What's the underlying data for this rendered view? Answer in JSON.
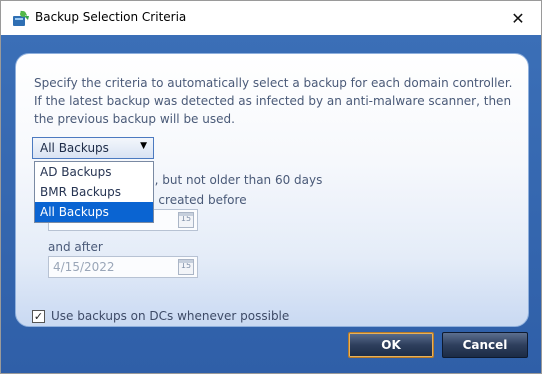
{
  "window": {
    "title": "Backup Selection Criteria"
  },
  "description": "Specify the criteria to automatically select a backup for each domain controller. If the latest backup was detected as infected by an anti-malware scanner, then the previous backup will be used.",
  "backup_type": {
    "selected": "All Backups",
    "options": [
      "AD Backups",
      "BMR Backups",
      "All Backups"
    ]
  },
  "options": {
    "latest_partial": "p, but not older than 60 days",
    "before_partial": "p created before",
    "and_after_label": "and after",
    "after_date": "4/15/2022",
    "calendar_glyph": "15"
  },
  "checkbox": {
    "label": "Use backups on DCs whenever possible",
    "checked": true
  },
  "buttons": {
    "ok": "OK",
    "cancel": "Cancel"
  }
}
